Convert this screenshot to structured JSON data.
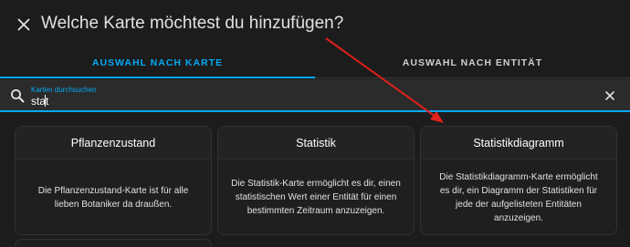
{
  "dialog": {
    "title": "Welche Karte möchtest du hinzufügen?",
    "close_icon": "close-icon"
  },
  "tabs": [
    {
      "label": "AUSWAHL NACH KARTE",
      "active": true
    },
    {
      "label": "AUSWAHL NACH ENTITÄT",
      "active": false
    }
  ],
  "search": {
    "label": "Karten durchsuchen",
    "value": "stat",
    "icon": "search-icon",
    "clear_icon": "clear-icon"
  },
  "cards": [
    {
      "title": "Pflanzenzustand",
      "description": "Die Pflanzenzustand-Karte ist für alle lieben Botaniker da draußen."
    },
    {
      "title": "Statistik",
      "description": "Die Statistik-Karte ermöglicht es dir, einen statistischen Wert einer Entität für einen bestimmten Zeitraum anzuzeigen."
    },
    {
      "title": "Statistikdiagramm",
      "description": "Die Statistikdiagramm-Karte ermöglicht es dir, ein Diagramm der Statistiken für jede der aufgelisteten Entitäten anzuzeigen."
    }
  ],
  "colors": {
    "accent": "#03a9f4",
    "background": "#1c1c1c",
    "annotation_arrow": "#e0201c"
  }
}
